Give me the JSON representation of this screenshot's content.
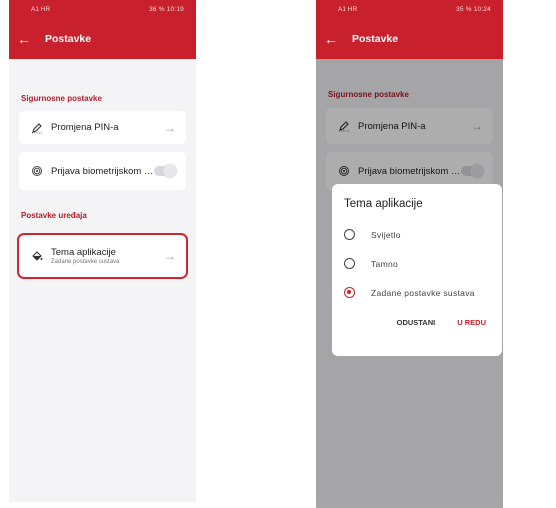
{
  "colors": {
    "accent": "#c8202d",
    "background": "#f4f4f7"
  },
  "left": {
    "status": {
      "carrier": "A1 HR",
      "right": "36 % 10:19"
    },
    "appbar": {
      "title": "Postavke",
      "back_icon": "arrow-left-icon"
    },
    "security_title": "Sigurnosne postavke",
    "pin_label": "Promjena PIN-a",
    "bio_label": "Prijava biometrijskom met...",
    "device_title": "Postavke uređaja",
    "theme_label": "Tema aplikacije",
    "theme_sub": "Zadane postavke sustava"
  },
  "right": {
    "status": {
      "carrier": "A1 HR",
      "right": "35 % 10:24"
    },
    "appbar": {
      "title": "Postavke",
      "back_icon": "arrow-left-icon"
    },
    "security_title": "Sigurnosne postavke",
    "pin_label": "Promjena PIN-a",
    "bio_label": "Prijava biometrijskom met...",
    "dialog": {
      "title": "Tema aplikacije",
      "options": [
        "Svijetlo",
        "Tamno",
        "Zadane postavke sustava"
      ],
      "selected": 2,
      "cancel": "ODUSTANI",
      "ok": "U REDU"
    }
  }
}
